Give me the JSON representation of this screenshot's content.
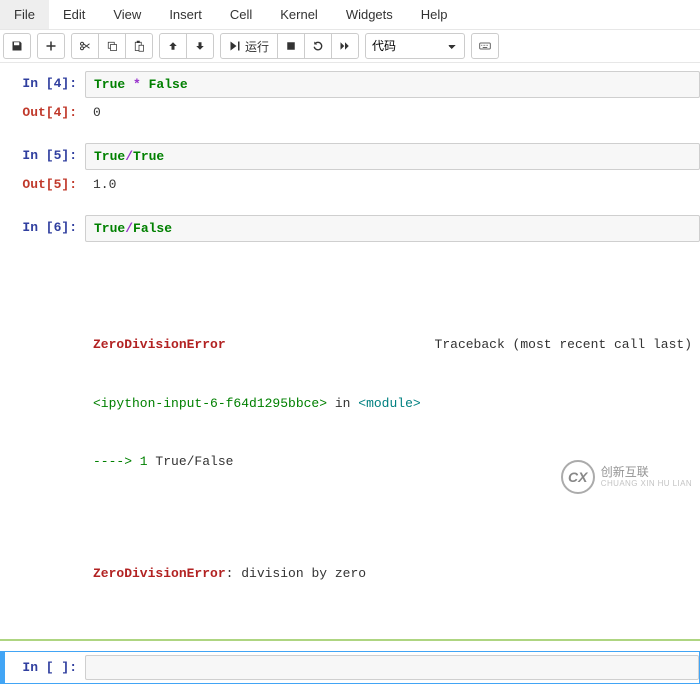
{
  "menu": {
    "file": "File",
    "edit": "Edit",
    "view": "View",
    "insert": "Insert",
    "cell": "Cell",
    "kernel": "Kernel",
    "widgets": "Widgets",
    "help": "Help"
  },
  "toolbar": {
    "run_label": "运行",
    "cell_type": "代码"
  },
  "cells": [
    {
      "in_prompt": "In [4]:",
      "code_tokens": [
        "True",
        " * ",
        "False"
      ],
      "out_prompt": "Out[4]:",
      "output": "0"
    },
    {
      "in_prompt": "In [5]:",
      "code_tokens": [
        "True",
        "/",
        "True"
      ],
      "out_prompt": "Out[5]:",
      "output": "1.0"
    },
    {
      "in_prompt": "In [6]:",
      "code_tokens": [
        "True",
        "/",
        "False"
      ],
      "traceback": {
        "error_name": "ZeroDivisionError",
        "traceback_label": "Traceback (most recent call last)",
        "location": "<ipython-input-6-f64d1295bbce>",
        "in_word": " in ",
        "module": "<module>",
        "arrow": "----> 1 ",
        "code": "True/False",
        "final_prefix": "ZeroDivisionError",
        "final_msg": ": division by zero"
      }
    },
    {
      "in_prompt": "In [ ]:"
    }
  ],
  "watermark": {
    "logo": "CX",
    "text": "创新互联",
    "sub": "CHUANG XIN HU LIAN"
  }
}
